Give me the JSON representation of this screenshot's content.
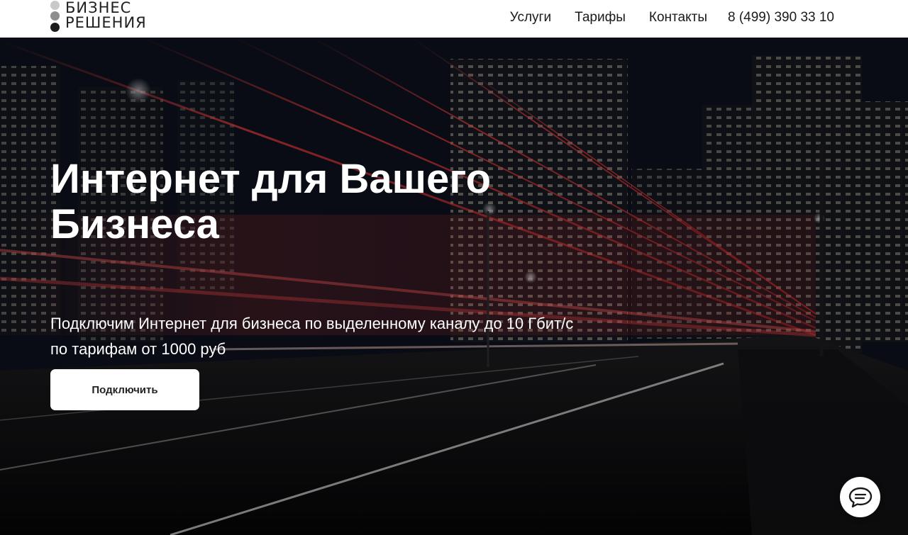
{
  "header": {
    "logo_line1": "БИЗНЕС",
    "logo_line2": "РЕШЕНИЯ",
    "nav": [
      "Услуги",
      "Тарифы",
      "Контакты"
    ],
    "phone": "8 (499) 390 33 10"
  },
  "hero": {
    "title": "Интернет для Вашего Бизнеса",
    "subtitle": "Подключим Интернет для бизнеса по выделенному каналу до 10 Гбит/с по тарифам от 1000 руб",
    "cta_label": "Подключить"
  },
  "icons": {
    "chat": "chat-bubble-icon"
  },
  "colors": {
    "header_bg": "#ffffff",
    "cta_bg": "#ffffff",
    "light_trail": "#ff3b3b"
  }
}
